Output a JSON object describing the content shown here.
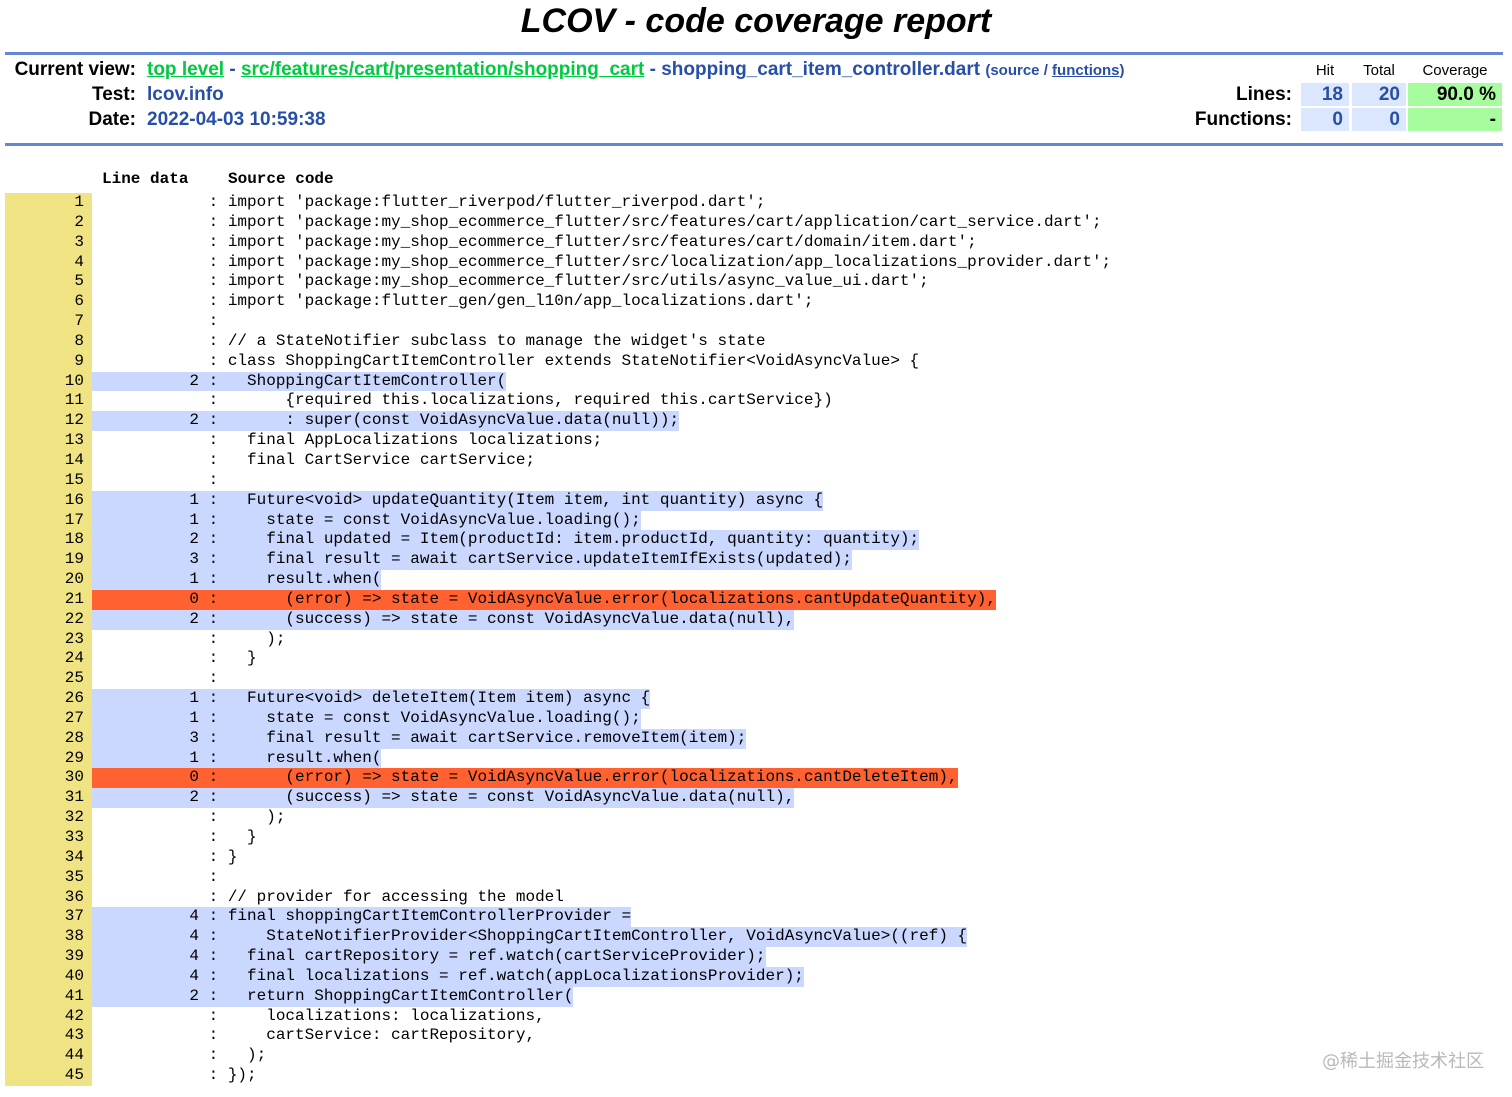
{
  "title": "LCOV - code coverage report",
  "header": {
    "current_view_label": "Current view:",
    "crumb_top": "top level",
    "crumb_sep1": " - ",
    "crumb_dir": "src/features/cart/presentation/shopping_cart",
    "crumb_sep2": " - ",
    "crumb_file": "shopping_cart_item_controller.dart",
    "source_label": "(source / ",
    "functions_label": "functions",
    "close_paren": ")",
    "test_label": "Test:",
    "test_value": "lcov.info",
    "date_label": "Date:",
    "date_value": "2022-04-03 10:59:38"
  },
  "summary": {
    "col_hit": "Hit",
    "col_total": "Total",
    "col_coverage": "Coverage",
    "lines_label": "Lines:",
    "lines_hit": "18",
    "lines_total": "20",
    "lines_coverage": "90.0 %",
    "functions_label": "Functions:",
    "functions_hit": "0",
    "functions_total": "0",
    "functions_coverage": "-"
  },
  "columns": {
    "line_data": "Line data",
    "source_code": "Source code"
  },
  "colors": {
    "hit": "#cad7fe",
    "miss": "#ff6230",
    "line_number_bg": "#efe383",
    "rule": "#6688d4"
  },
  "lines": [
    {
      "n": "1",
      "hits": "",
      "cls": "",
      "code": "import 'package:flutter_riverpod/flutter_riverpod.dart';"
    },
    {
      "n": "2",
      "hits": "",
      "cls": "",
      "code": "import 'package:my_shop_ecommerce_flutter/src/features/cart/application/cart_service.dart';"
    },
    {
      "n": "3",
      "hits": "",
      "cls": "",
      "code": "import 'package:my_shop_ecommerce_flutter/src/features/cart/domain/item.dart';"
    },
    {
      "n": "4",
      "hits": "",
      "cls": "",
      "code": "import 'package:my_shop_ecommerce_flutter/src/localization/app_localizations_provider.dart';"
    },
    {
      "n": "5",
      "hits": "",
      "cls": "",
      "code": "import 'package:my_shop_ecommerce_flutter/src/utils/async_value_ui.dart';"
    },
    {
      "n": "6",
      "hits": "",
      "cls": "",
      "code": "import 'package:flutter_gen/gen_l10n/app_localizations.dart';"
    },
    {
      "n": "7",
      "hits": "",
      "cls": "",
      "code": ""
    },
    {
      "n": "8",
      "hits": "",
      "cls": "",
      "code": "// a StateNotifier subclass to manage the widget's state"
    },
    {
      "n": "9",
      "hits": "",
      "cls": "",
      "code": "class ShoppingCartItemController extends StateNotifier<VoidAsyncValue> {"
    },
    {
      "n": "10",
      "hits": "2",
      "cls": "hit",
      "code": "  ShoppingCartItemController("
    },
    {
      "n": "11",
      "hits": "",
      "cls": "",
      "code": "      {required this.localizations, required this.cartService})"
    },
    {
      "n": "12",
      "hits": "2",
      "cls": "hit",
      "code": "      : super(const VoidAsyncValue.data(null));"
    },
    {
      "n": "13",
      "hits": "",
      "cls": "",
      "code": "  final AppLocalizations localizations;"
    },
    {
      "n": "14",
      "hits": "",
      "cls": "",
      "code": "  final CartService cartService;"
    },
    {
      "n": "15",
      "hits": "",
      "cls": "",
      "code": ""
    },
    {
      "n": "16",
      "hits": "1",
      "cls": "hit",
      "code": "  Future<void> updateQuantity(Item item, int quantity) async {"
    },
    {
      "n": "17",
      "hits": "1",
      "cls": "hit",
      "code": "    state = const VoidAsyncValue.loading();"
    },
    {
      "n": "18",
      "hits": "2",
      "cls": "hit",
      "code": "    final updated = Item(productId: item.productId, quantity: quantity);"
    },
    {
      "n": "19",
      "hits": "3",
      "cls": "hit",
      "code": "    final result = await cartService.updateItemIfExists(updated);"
    },
    {
      "n": "20",
      "hits": "1",
      "cls": "hit",
      "code": "    result.when("
    },
    {
      "n": "21",
      "hits": "0",
      "cls": "miss",
      "code": "      (error) => state = VoidAsyncValue.error(localizations.cantUpdateQuantity),"
    },
    {
      "n": "22",
      "hits": "2",
      "cls": "hit",
      "code": "      (success) => state = const VoidAsyncValue.data(null),"
    },
    {
      "n": "23",
      "hits": "",
      "cls": "",
      "code": "    );"
    },
    {
      "n": "24",
      "hits": "",
      "cls": "",
      "code": "  }"
    },
    {
      "n": "25",
      "hits": "",
      "cls": "",
      "code": ""
    },
    {
      "n": "26",
      "hits": "1",
      "cls": "hit",
      "code": "  Future<void> deleteItem(Item item) async {"
    },
    {
      "n": "27",
      "hits": "1",
      "cls": "hit",
      "code": "    state = const VoidAsyncValue.loading();"
    },
    {
      "n": "28",
      "hits": "3",
      "cls": "hit",
      "code": "    final result = await cartService.removeItem(item);"
    },
    {
      "n": "29",
      "hits": "1",
      "cls": "hit",
      "code": "    result.when("
    },
    {
      "n": "30",
      "hits": "0",
      "cls": "miss",
      "code": "      (error) => state = VoidAsyncValue.error(localizations.cantDeleteItem),"
    },
    {
      "n": "31",
      "hits": "2",
      "cls": "hit",
      "code": "      (success) => state = const VoidAsyncValue.data(null),"
    },
    {
      "n": "32",
      "hits": "",
      "cls": "",
      "code": "    );"
    },
    {
      "n": "33",
      "hits": "",
      "cls": "",
      "code": "  }"
    },
    {
      "n": "34",
      "hits": "",
      "cls": "",
      "code": "}"
    },
    {
      "n": "35",
      "hits": "",
      "cls": "",
      "code": ""
    },
    {
      "n": "36",
      "hits": "",
      "cls": "",
      "code": "// provider for accessing the model"
    },
    {
      "n": "37",
      "hits": "4",
      "cls": "hit",
      "code": "final shoppingCartItemControllerProvider ="
    },
    {
      "n": "38",
      "hits": "4",
      "cls": "hit",
      "code": "    StateNotifierProvider<ShoppingCartItemController, VoidAsyncValue>((ref) {"
    },
    {
      "n": "39",
      "hits": "4",
      "cls": "hit",
      "code": "  final cartRepository = ref.watch(cartServiceProvider);"
    },
    {
      "n": "40",
      "hits": "4",
      "cls": "hit",
      "code": "  final localizations = ref.watch(appLocalizationsProvider);"
    },
    {
      "n": "41",
      "hits": "2",
      "cls": "hit",
      "code": "  return ShoppingCartItemController("
    },
    {
      "n": "42",
      "hits": "",
      "cls": "",
      "code": "    localizations: localizations,"
    },
    {
      "n": "43",
      "hits": "",
      "cls": "",
      "code": "    cartService: cartRepository,"
    },
    {
      "n": "44",
      "hits": "",
      "cls": "",
      "code": "  );"
    },
    {
      "n": "45",
      "hits": "",
      "cls": "",
      "code": "});"
    }
  ],
  "watermark": "@稀土掘金技术社区"
}
